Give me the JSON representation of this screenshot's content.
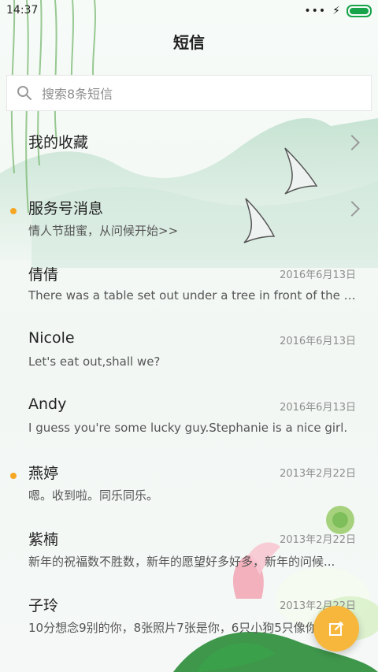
{
  "status": {
    "time": "14:37",
    "dots": "•••",
    "bolt": "⚡"
  },
  "header": {
    "title": "短信"
  },
  "search": {
    "placeholder": "搜索8条短信"
  },
  "rows": [
    {
      "title": "我的收藏",
      "preview": "",
      "date": "",
      "unread": false,
      "chevron": true
    },
    {
      "title": "服务号消息",
      "preview": "情人节甜蜜，从问候开始>>",
      "date": "",
      "unread": true,
      "chevron": true
    },
    {
      "title": "倩倩",
      "preview": "There was a table set out under a tree in front of the ho...",
      "date": "2016年6月13日",
      "unread": false,
      "chevron": false
    },
    {
      "title": "Nicole",
      "preview": "Let's eat out,shall we?",
      "date": "2016年6月13日",
      "unread": false,
      "chevron": false
    },
    {
      "title": "Andy",
      "preview": "I guess you're some lucky guy.Stephanie is a nice girl.",
      "date": "2016年6月13日",
      "unread": false,
      "chevron": false
    },
    {
      "title": "燕婷",
      "preview": "嗯。收到啦。同乐同乐。",
      "date": "2013年2月22日",
      "unread": true,
      "chevron": false
    },
    {
      "title": "紫楠",
      "preview": "新年的祝福数不胜数，新年的愿望好多好多，新年的问候...",
      "date": "2013年2月22日",
      "unread": false,
      "chevron": false
    },
    {
      "title": "子玲",
      "preview": "10分想念9别的你，8张照片7张是你，6只小狗5只像你",
      "date": "2013年2月22日",
      "unread": false,
      "chevron": false
    }
  ],
  "colors": {
    "unread_dot": "#f5a623",
    "fab": "#f6b73c",
    "battery": "#16a34a"
  },
  "icons": {
    "search": "search-icon",
    "compose": "compose-icon",
    "chevron": "chevron-right-icon"
  }
}
